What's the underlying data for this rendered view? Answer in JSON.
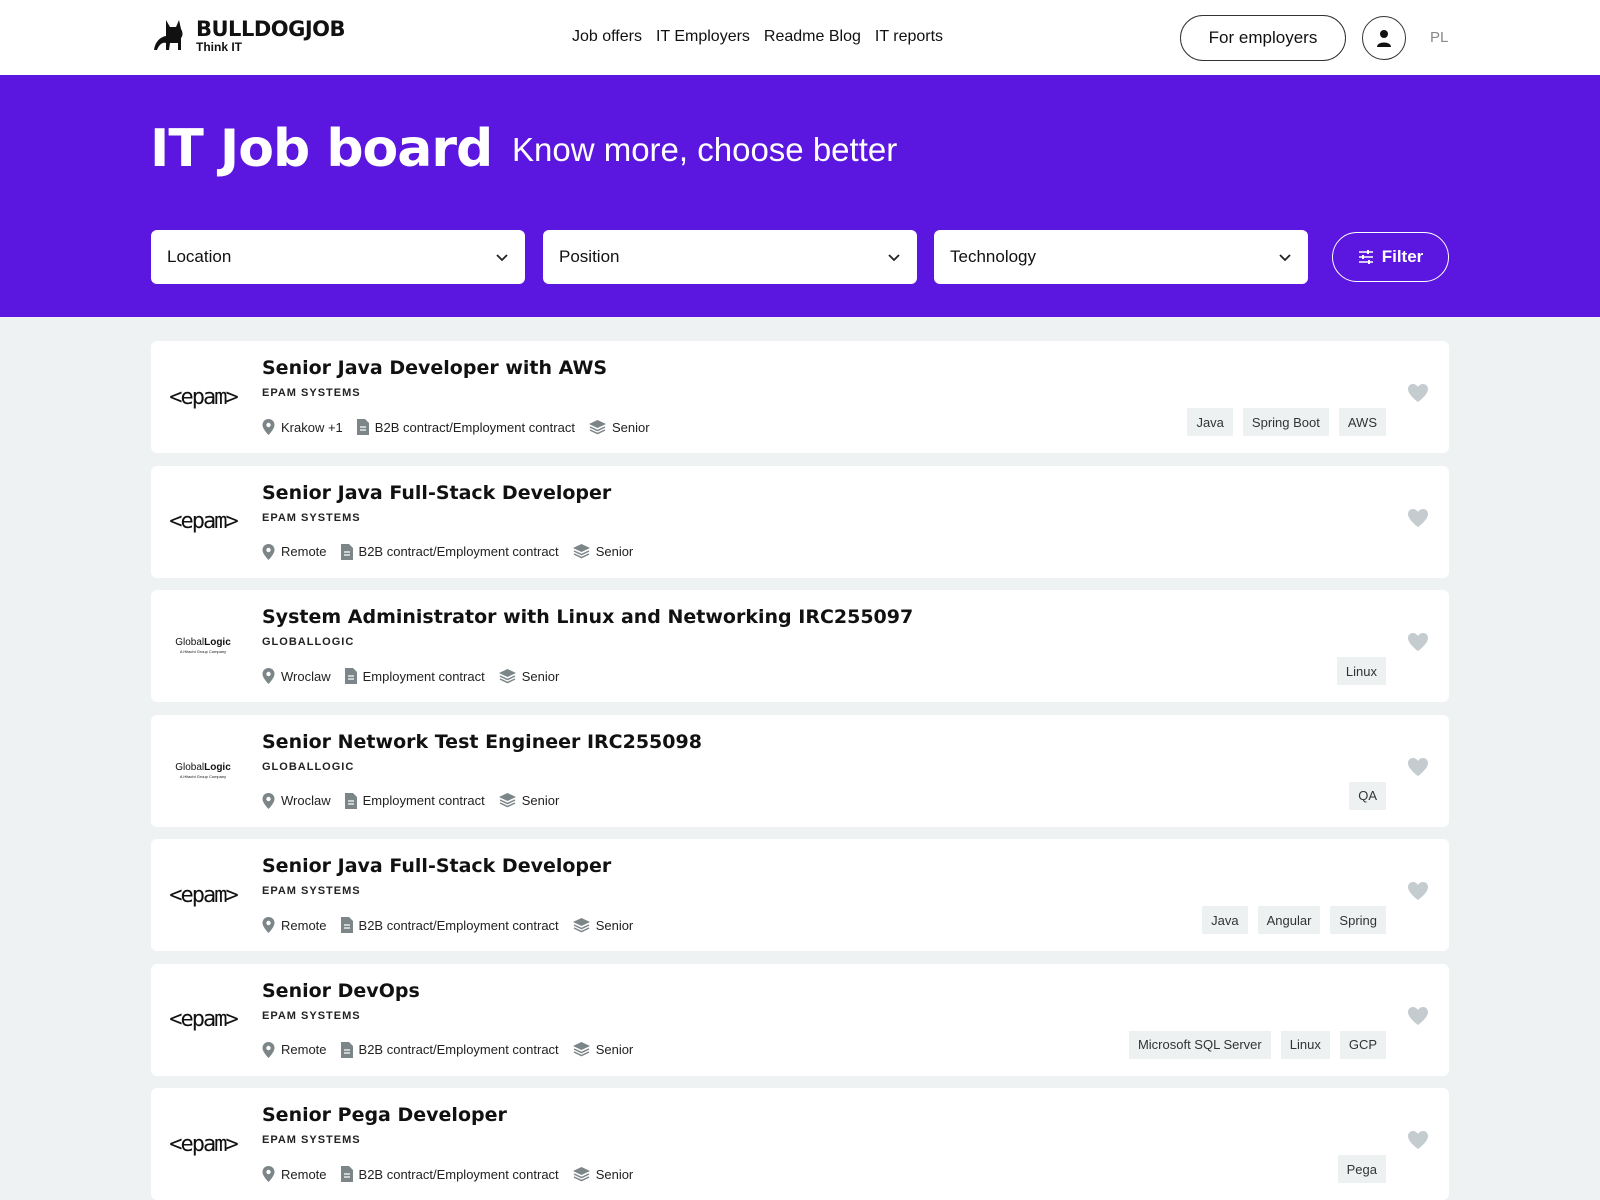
{
  "header": {
    "logo_name": "BULLDOGJOB",
    "logo_tagline": "Think IT",
    "nav": [
      "Job offers",
      "IT Employers",
      "Readme Blog",
      "IT reports"
    ],
    "employers_label": "For employers",
    "lang": "PL"
  },
  "hero": {
    "title": "IT Job board",
    "subtitle": "Know more, choose better",
    "filters": [
      "Location",
      "Position",
      "Technology"
    ],
    "filter_button": "Filter"
  },
  "colors": {
    "accent": "#5b17df",
    "page_bg": "#eef2f3",
    "tag_bg": "#edf1f2",
    "heart": "#c4cccf"
  },
  "jobs": [
    {
      "title": "Senior Java Developer with AWS",
      "company": "EPAM SYSTEMS",
      "logo": "epam",
      "location": "Krakow +1",
      "contract": "B2B contract/Employment contract",
      "level": "Senior",
      "tags": [
        "Java",
        "Spring Boot",
        "AWS"
      ]
    },
    {
      "title": "Senior Java Full-Stack Developer",
      "company": "EPAM SYSTEMS",
      "logo": "epam",
      "location": "Remote",
      "contract": "B2B contract/Employment contract",
      "level": "Senior",
      "tags": []
    },
    {
      "title": "System Administrator with Linux and Networking IRC255097",
      "company": "GLOBALLOGIC",
      "logo": "globallogic",
      "location": "Wroclaw",
      "contract": "Employment contract",
      "level": "Senior",
      "tags": [
        "Linux"
      ]
    },
    {
      "title": "Senior Network Test Engineer IRC255098",
      "company": "GLOBALLOGIC",
      "logo": "globallogic",
      "location": "Wroclaw",
      "contract": "Employment contract",
      "level": "Senior",
      "tags": [
        "QA"
      ]
    },
    {
      "title": "Senior Java Full-Stack Developer",
      "company": "EPAM SYSTEMS",
      "logo": "epam",
      "location": "Remote",
      "contract": "B2B contract/Employment contract",
      "level": "Senior",
      "tags": [
        "Java",
        "Angular",
        "Spring"
      ]
    },
    {
      "title": "Senior DevOps",
      "company": "EPAM SYSTEMS",
      "logo": "epam",
      "location": "Remote",
      "contract": "B2B contract/Employment contract",
      "level": "Senior",
      "tags": [
        "Microsoft SQL Server",
        "Linux",
        "GCP"
      ]
    },
    {
      "title": "Senior Pega Developer",
      "company": "EPAM SYSTEMS",
      "logo": "epam",
      "location": "Remote",
      "contract": "B2B contract/Employment contract",
      "level": "Senior",
      "tags": [
        "Pega"
      ]
    }
  ],
  "logo_texts": {
    "epam": "<epam>",
    "globallogic_a": "Global",
    "globallogic_b": "Logic",
    "globallogic_sub": "A Hitachi Group Company"
  }
}
